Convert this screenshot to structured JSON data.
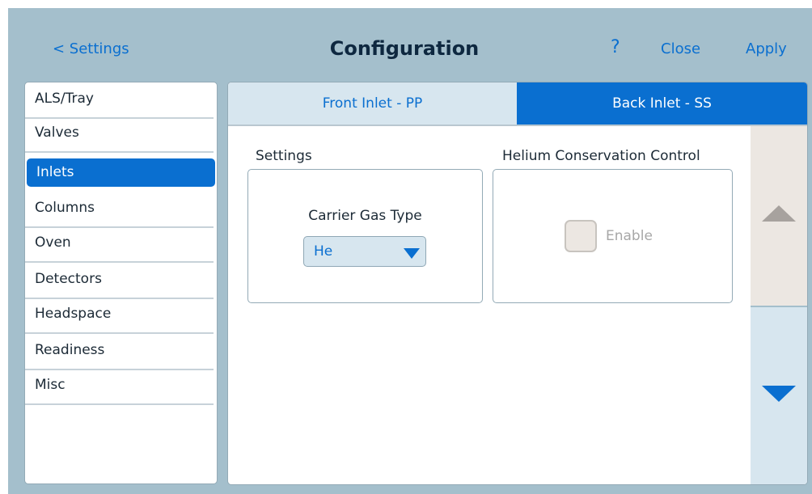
{
  "header": {
    "back_label": "< Settings",
    "title": "Configuration",
    "help_label": "?",
    "close_label": "Close",
    "apply_label": "Apply"
  },
  "sidebar": {
    "items": [
      {
        "label": "ALS/Tray"
      },
      {
        "label": "Valves"
      },
      {
        "label": "Inlets"
      },
      {
        "label": "Columns"
      },
      {
        "label": "Oven"
      },
      {
        "label": "Detectors"
      },
      {
        "label": "Headspace"
      },
      {
        "label": "Readiness"
      },
      {
        "label": "Misc"
      }
    ],
    "selected": "Inlets"
  },
  "tabs": [
    {
      "label": "Front Inlet - PP"
    },
    {
      "label": "Back Inlet - SS"
    }
  ],
  "active_tab": "Back Inlet - SS",
  "settings_group": {
    "title": "Settings",
    "carrier_label": "Carrier Gas Type",
    "carrier_value": "He"
  },
  "helium_group": {
    "title": "Helium Conservation Control",
    "enable_label": "Enable",
    "enabled": false
  },
  "scroll": {
    "up_icon": "triangle-up-icon",
    "down_icon": "triangle-down-icon"
  },
  "colors": {
    "accent": "#0a6fd0",
    "frame_bg": "#a4bfcc",
    "tab_inactive_bg": "#d7e6ef",
    "scroll_up_bg": "#ece7e2"
  }
}
